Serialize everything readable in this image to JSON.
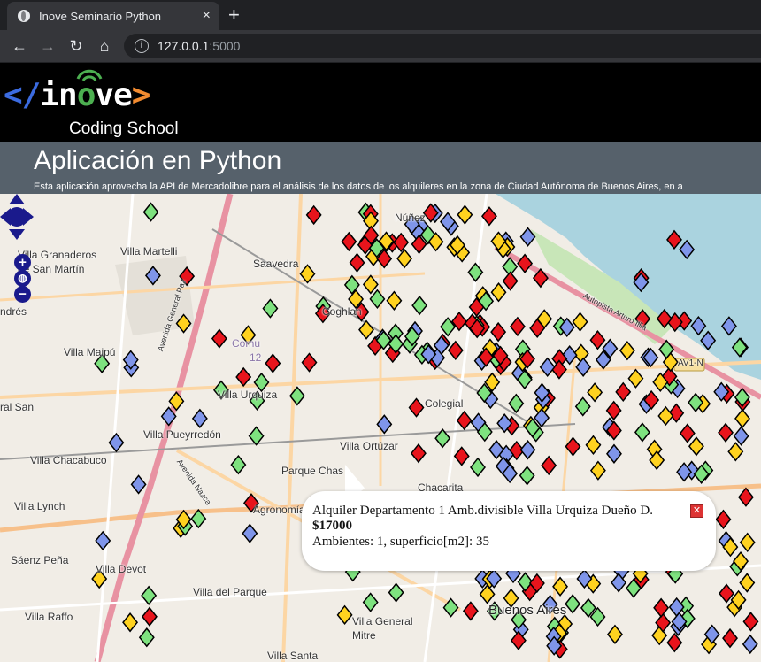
{
  "browser": {
    "tab_title": "Inove Seminario Python",
    "tab_close": "×",
    "new_tab": "+",
    "url_host": "127.0.0.1",
    "url_port": ":5000"
  },
  "site": {
    "logo_left": "</",
    "logo_word": "in",
    "logo_o": "o",
    "logo_tail": "ve",
    "logo_right": ">",
    "logo_sub": "Coding School",
    "title": "Aplicación en Python",
    "description": "Esta aplicación aprovecha la API de Mercadolibre para el análisis de los datos de los alquileres en la zona de Ciudad Autónoma de Buenos Aires, en a"
  },
  "map": {
    "labels": {
      "nunez": "Núñez",
      "villa_granaderos": "Villa Granaderos",
      "de_san_martin": "de San Martín",
      "villa_martelli": "Villa Martelli",
      "saavedra": "Saavedra",
      "coghlan": "Coghlan",
      "andres": "ndrés",
      "villa_maipu": "Villa Maipú",
      "comuna": "Comu",
      "comuna_num": "12",
      "villa_urquiza": "Villa Urquiza",
      "colegiales": "Colegial",
      "ral_san": "ral San",
      "villa_pueyrredon": "Villa Pueyrredón",
      "villa_ortuzar": "Villa Ortúzar",
      "villa_chacabuco": "Villa Chacabuco",
      "parque_chas": "Parque Chas",
      "chacarita": "Chacarita",
      "villa_lynch": "Villa Lynch",
      "agronomia": "Agronomía",
      "saenz_pena": "Sáenz Peña",
      "villa_devoto": "Villa Devot",
      "villa_del_parque": "Villa del Parque",
      "villa_raffo": "Villa Raffo",
      "villa_general": "Villa General",
      "mitre": "Mitre",
      "villa_santa": "Villa Santa",
      "buenos_aires": "Buenos Aires",
      "av1n": "AV1-N",
      "autopista": "Autopista Arturo Illia",
      "av_general_paz": "Avenida General Paz",
      "av_nazca": "Avenida Nazca"
    },
    "colors": {
      "red": "#e8141c",
      "blue": "#7f95ea",
      "green": "#7ee27f",
      "yellow": "#ffd21f",
      "water": "#aad3df",
      "park": "#c8e6b8"
    },
    "zoom_in": "+",
    "zoom_out": "−",
    "popup": {
      "title": "Alquiler Departamento 1 Amb.divisible Villa Urquiza Dueño D.",
      "price": "$17000",
      "details": "Ambientes: 1, superficio[m2]: 35",
      "close": "✕"
    }
  }
}
